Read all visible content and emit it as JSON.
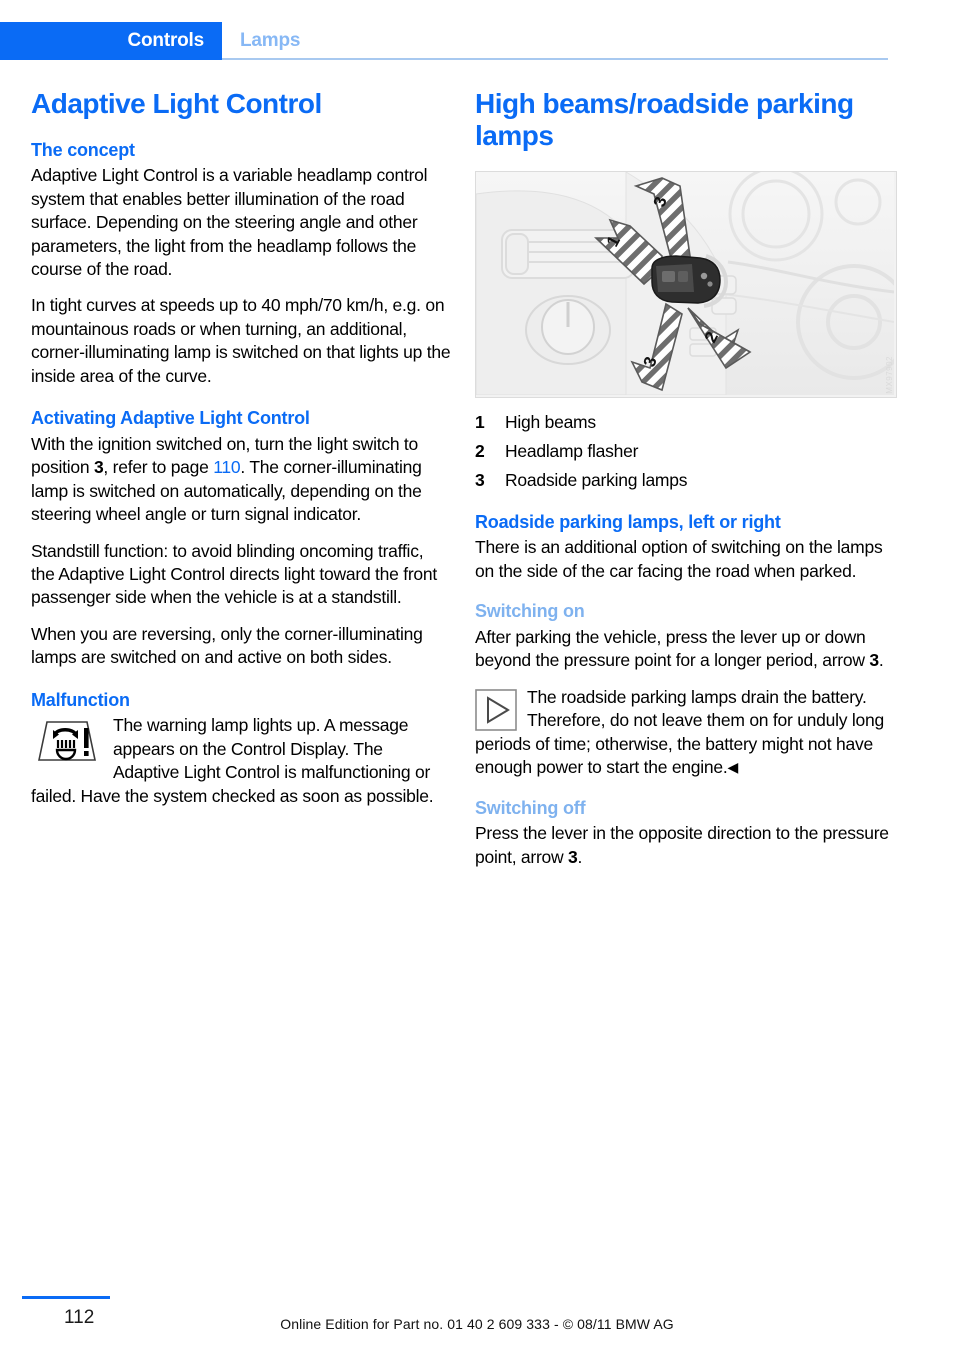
{
  "header": {
    "tab_label": "Controls",
    "section_label": "Lamps"
  },
  "left_column": {
    "title": "Adaptive Light Control",
    "sections": [
      {
        "heading": "The concept",
        "paragraphs": [
          "Adaptive Light Control is a variable headlamp control system that enables better illumination of the road surface. Depending on the steering angle and other parameters, the light from the headlamp follows the course of the road.",
          "In tight curves at speeds up to 40 mph/70 km/h, e.g. on mountainous roads or when turning, an additional, corner-illuminating lamp is switched on that lights up the inside area of the curve."
        ]
      },
      {
        "heading": "Activating Adaptive Light Control",
        "para1_a": "With the ignition switched on, turn the light switch to position ",
        "para1_pos": "3",
        "para1_b": ", refer to page ",
        "para1_pageref": "110",
        "para1_c": ". The corner-illuminating lamp is switched on automatically, depending on the steering wheel angle or turn signal indicator.",
        "para2": "Standstill function: to avoid blinding oncoming traffic, the Adaptive Light Control directs light toward the front passenger side when the vehicle is at a standstill.",
        "para3": "When you are reversing, only the corner-illuminating lamps are switched on and active on both sides."
      },
      {
        "heading": "Malfunction",
        "icon": "headlamp-malfunction-warning-icon",
        "paragraph": "The warning lamp lights up. A message appears on the Control Display. The Adaptive Light Control is malfunctioning or failed. Have the system checked as soon as possible."
      }
    ]
  },
  "right_column": {
    "title": "High beams/roadside parking lamps",
    "figure": {
      "name": "steering-column-stalk-illustration",
      "watermark": "MX97902",
      "arrow_labels": [
        "1",
        "2",
        "3",
        "3"
      ]
    },
    "legend": [
      {
        "num": "1",
        "text": "High beams"
      },
      {
        "num": "2",
        "text": "Headlamp flasher"
      },
      {
        "num": "3",
        "text": "Roadside parking lamps"
      }
    ],
    "sections": [
      {
        "heading": "Roadside parking lamps, left or right",
        "paragraph": "There is an additional option of switching on the lamps on the side of the car facing the road when parked."
      },
      {
        "heading": "Switching on",
        "para_a": "After parking the vehicle, press the lever up or down beyond the pressure point for a longer period, arrow ",
        "para_num": "3",
        "para_b": ".",
        "note": {
          "icon": "triangle-note-icon",
          "text": "The roadside parking lamps drain the battery. Therefore, do not leave them on for unduly long periods of time; otherwise, the battery might not have enough power to start the engine.",
          "endmark": "◀"
        }
      },
      {
        "heading": "Switching off",
        "para_a": "Press the lever in the opposite direction to the pressure point, arrow ",
        "para_num": "3",
        "para_b": "."
      }
    ]
  },
  "footer": {
    "page_number": "112",
    "edition_note": "Online Edition for Part no. 01 40 2 609 333 - © 08/11 BMW AG"
  },
  "colors": {
    "primary_blue": "#0a6bf5",
    "light_blue": "#87b8f5",
    "secondary_heading_blue": "#7fb2ef"
  }
}
